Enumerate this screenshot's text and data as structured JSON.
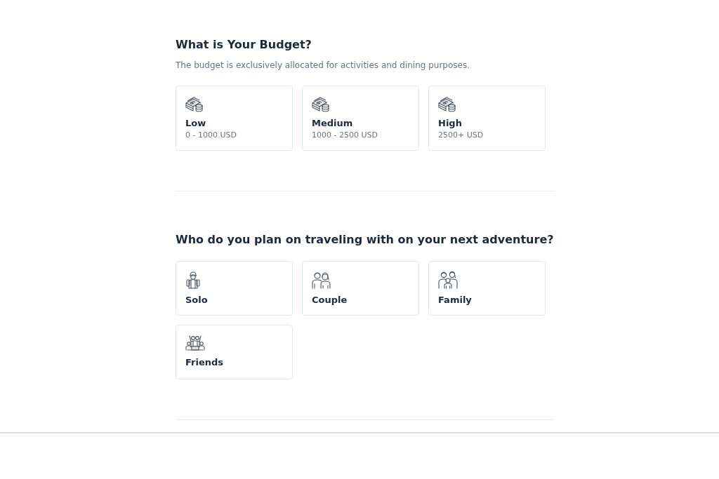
{
  "sections": [
    {
      "kind": "budget",
      "title": "What is Your Budget?",
      "subtitle": "The budget is exclusively allocated for activities and dining purposes.",
      "options": [
        {
          "label": "Low",
          "detail": "0 - 1000 USD",
          "selected": false
        },
        {
          "label": "Medium",
          "detail": "1000 - 2500 USD",
          "selected": false
        },
        {
          "label": "High",
          "detail": "2500+ USD",
          "selected": false
        }
      ]
    },
    {
      "kind": "companions",
      "title": "Who do you plan on traveling with on your next adventure?",
      "options": [
        {
          "label": "Solo",
          "selected": false
        },
        {
          "label": "Couple",
          "selected": false
        },
        {
          "label": "Family",
          "selected": false
        },
        {
          "label": "Friends",
          "selected": false
        }
      ]
    }
  ]
}
